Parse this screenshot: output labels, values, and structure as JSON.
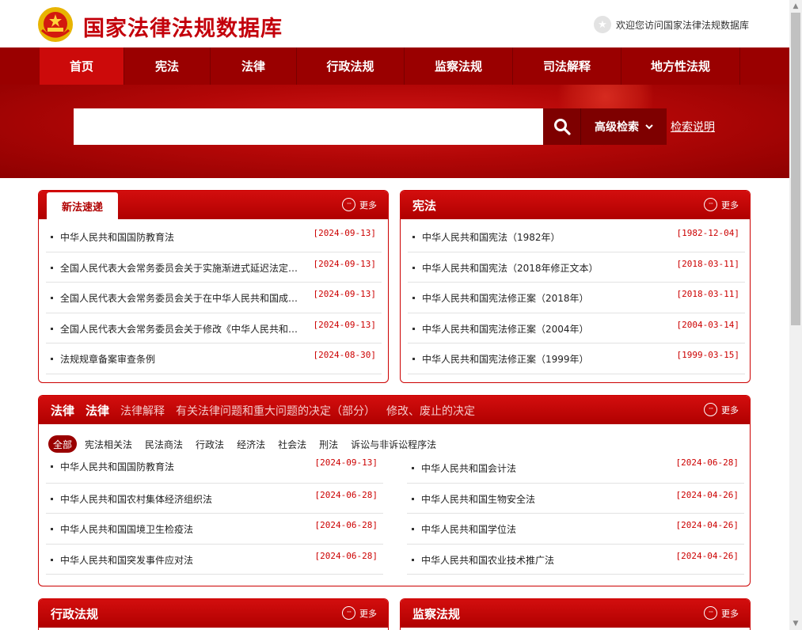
{
  "header": {
    "site_title": "国家法律法规数据库",
    "welcome": "欢迎您访问国家法律法规数据库"
  },
  "nav": {
    "items": [
      "首页",
      "宪法",
      "法律",
      "行政法规",
      "监察法规",
      "司法解释",
      "地方性法规"
    ],
    "active_index": 0
  },
  "search": {
    "value": "",
    "advanced_label": "高级检索",
    "help_label": "检索说明"
  },
  "more_label": "更多",
  "new_laws": {
    "tab_label": "新法速递",
    "items": [
      {
        "title": "中华人民共和国国防教育法",
        "date": "[2024-09-13]"
      },
      {
        "title": "全国人民代表大会常务委员会关于实施渐进式延迟法定…",
        "date": "[2024-09-13]"
      },
      {
        "title": "全国人民代表大会常务委员会关于在中华人民共和国成…",
        "date": "[2024-09-13]"
      },
      {
        "title": "全国人民代表大会常务委员会关于修改《中华人民共和…",
        "date": "[2024-09-13]"
      },
      {
        "title": "法规规章备案审查条例",
        "date": "[2024-08-30]"
      }
    ]
  },
  "constitution": {
    "title": "宪法",
    "items": [
      {
        "title": "中华人民共和国宪法（1982年）",
        "date": "[1982-12-04]"
      },
      {
        "title": "中华人民共和国宪法（2018年修正文本）",
        "date": "[2018-03-11]"
      },
      {
        "title": "中华人民共和国宪法修正案（2018年）",
        "date": "[2018-03-11]"
      },
      {
        "title": "中华人民共和国宪法修正案（2004年）",
        "date": "[2004-03-14]"
      },
      {
        "title": "中华人民共和国宪法修正案（1999年）",
        "date": "[1999-03-15]"
      }
    ]
  },
  "laws": {
    "tabs": [
      "法律",
      "法律",
      "法律解释",
      "有关法律问题和重大问题的决定（部分）",
      "修改、废止的决定"
    ],
    "categories": [
      "全部",
      "宪法相关法",
      "民法商法",
      "行政法",
      "经济法",
      "社会法",
      "刑法",
      "诉讼与非诉讼程序法"
    ],
    "active_category": 0,
    "left_items": [
      {
        "title": "中华人民共和国国防教育法",
        "date": "[2024-09-13]"
      },
      {
        "title": "中华人民共和国农村集体经济组织法",
        "date": "[2024-06-28]"
      },
      {
        "title": "中华人民共和国国境卫生检疫法",
        "date": "[2024-06-28]"
      },
      {
        "title": "中华人民共和国突发事件应对法",
        "date": "[2024-06-28]"
      }
    ],
    "right_items": [
      {
        "title": "中华人民共和国会计法",
        "date": "[2024-06-28]"
      },
      {
        "title": "中华人民共和国生物安全法",
        "date": "[2024-04-26]"
      },
      {
        "title": "中华人民共和国学位法",
        "date": "[2024-04-26]"
      },
      {
        "title": "中华人民共和国农业技术推广法",
        "date": "[2024-04-26]"
      }
    ]
  },
  "admin_regs": {
    "title": "行政法规"
  },
  "supervision_regs": {
    "title": "监察法规"
  },
  "icons": {
    "emblem": "national-emblem-icon",
    "welcome": "star-badge-icon",
    "search": "search-icon",
    "chevron": "chevron-down-icon",
    "more": "more-dots-icon"
  },
  "colors": {
    "brand_red": "#c3000b",
    "nav_red": "#9a0000",
    "active_nav": "#cc0a0a",
    "date_red": "#cc0000"
  }
}
